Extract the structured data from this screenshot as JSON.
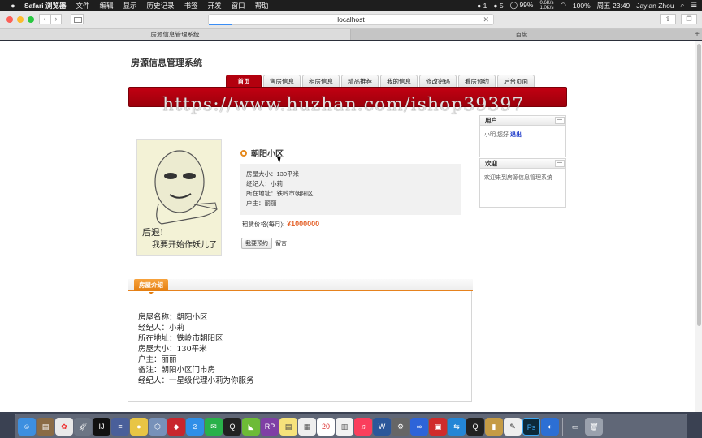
{
  "menubar": {
    "app": "Safari 浏览器",
    "menus": [
      "文件",
      "编辑",
      "显示",
      "历史记录",
      "书签",
      "开发",
      "窗口",
      "帮助"
    ],
    "status": {
      "notifications": "1",
      "qq_count": "5",
      "battery": "99%",
      "net_up": "0.6K/s",
      "net_down": "1.0K/s",
      "charge": "100%",
      "datetime": "周五 23:49",
      "user": "Jaylan Zhou"
    }
  },
  "browser": {
    "address": "localhost",
    "tabs": [
      "房源信息管理系统",
      "百度"
    ]
  },
  "site": {
    "title": "房源信息管理系统",
    "nav": [
      "首页",
      "售房信息",
      "租房信息",
      "精品推荐",
      "我的信息",
      "修改密码",
      "看房预约",
      "后台页面"
    ],
    "active_nav": "首页",
    "watermark": "https://www.huzhan.com/ishop39397"
  },
  "photo": {
    "caption_line1": "后退!",
    "caption_line2": "我要开始作妖儿了"
  },
  "house": {
    "name": "朝阳小区",
    "details": [
      "房屋大小：130平米",
      "经纪人：小莉",
      "所在地址：铁岭市朝阳区",
      "户主：丽丽"
    ],
    "price_label": "租赁价格(每月):",
    "price_value": "¥1000000",
    "book_button": "我要预约",
    "message_link": "留言"
  },
  "sidebar": {
    "user_panel": {
      "title": "用户",
      "greeting": "小明,您好",
      "logout": "退出"
    },
    "welcome_panel": {
      "title": "欢迎",
      "text": "欢迎来到房源信息管理系统"
    }
  },
  "intro": {
    "tab_label": "房屋介绍",
    "lines": [
      "房屋名称：朝阳小区",
      "经纪人：小莉",
      "所在地址：铁岭市朝阳区",
      "房屋大小：130平米",
      "户主：丽丽",
      "备注：朝阳小区门市房",
      "经纪人：一星级代理小莉为你服务"
    ]
  },
  "colors": {
    "brand_red": "#b3000e",
    "accent_orange": "#e6821e",
    "price_orange": "#e4622a"
  }
}
